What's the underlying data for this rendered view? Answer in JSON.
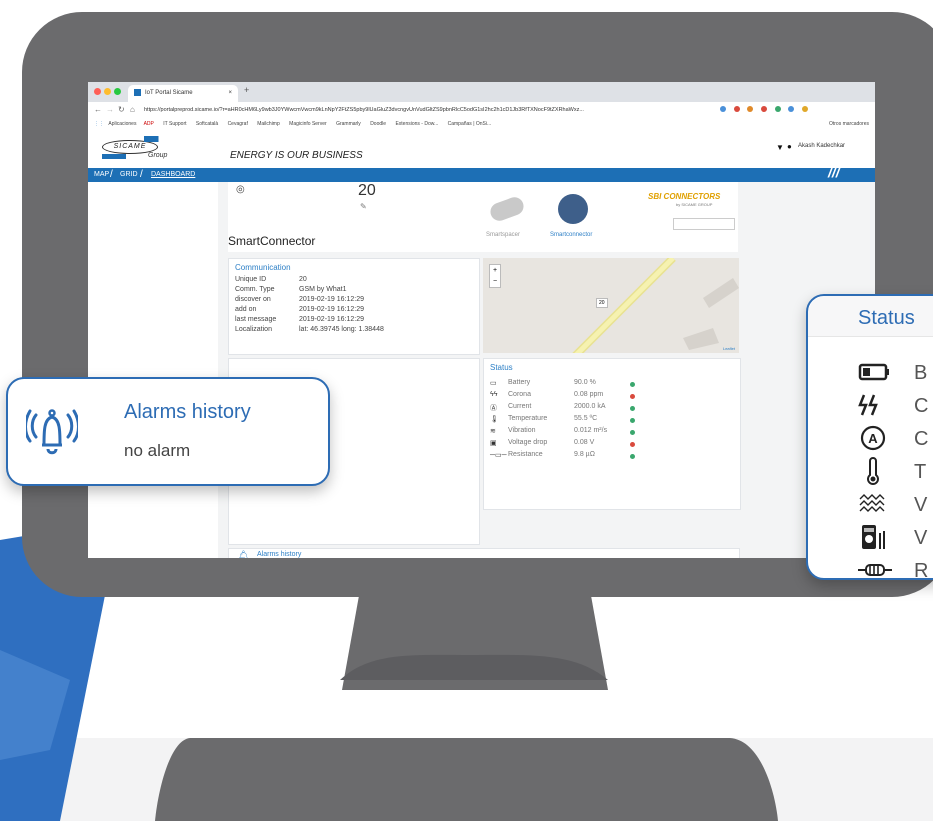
{
  "browser": {
    "tab_title": "IoT Portal Sicame",
    "tab_close": "×",
    "new_tab": "+",
    "url": "https://portalpreprod.sicame.io/?r=aHR0cHM6Ly9wb3J0YWwcmVwcm9kLnNpY2FtZS5pby9lUaGluZ3dvcngvUnVudGltZS9pbnRlcC5odG1sI2hc2h1cD1Jb3RfTXNocF9tZXRhaWxz...",
    "bookmarks": [
      "Aplicaciones",
      "ADP",
      "IT Support",
      "Softcatalà",
      "Cevagraf",
      "Mailchimp",
      "Magicinfo Server",
      "Grammarly",
      "Doodle",
      "Extensions - Dow...",
      "Campañas | OnSi..."
    ],
    "other_bookmarks": "Otros marcadores"
  },
  "site": {
    "logo_name": "SICAME",
    "logo_group": "Group",
    "tagline": "ENERGY IS OUR BUSINESS",
    "user": "Akash Kadechkar",
    "nav": [
      "MAP",
      "GRID",
      "DASHBOARD"
    ]
  },
  "device": {
    "id": "20",
    "name": "SmartConnector",
    "models": [
      "Smartspacer",
      "Smartconnector"
    ],
    "brand": "SBI CONNECTORS",
    "brand_sub": "by SICAME GROUP"
  },
  "communication": {
    "title": "Communication",
    "rows": [
      {
        "label": "Unique ID",
        "value": "20"
      },
      {
        "label": "Comm. Type",
        "value": "GSM by What1"
      },
      {
        "label": "discover on",
        "value": "2019-02-19 16:12:29"
      },
      {
        "label": "add on",
        "value": "2019-02-19 16:12:29"
      },
      {
        "label": "last message",
        "value": "2019-02-19 16:12:29"
      },
      {
        "label": "Localization",
        "value": "lat: 46.39745 long: 1.38448"
      }
    ]
  },
  "map": {
    "zoom_in": "+",
    "zoom_out": "−",
    "marker": "20",
    "attribution": "Leaflet"
  },
  "status": {
    "title": "Status",
    "rows": [
      {
        "icon": "battery-icon",
        "label": "Battery",
        "value": "90.0 %",
        "state": "#3aa76d"
      },
      {
        "icon": "lightning-icon",
        "label": "Corona",
        "value": "0.08 ppm",
        "state": "#d94a3d"
      },
      {
        "icon": "ampere-icon",
        "label": "Current",
        "value": "2000.0 kA",
        "state": "#3aa76d"
      },
      {
        "icon": "thermometer-icon",
        "label": "Temperature",
        "value": "55.5 ºC",
        "state": "#3aa76d"
      },
      {
        "icon": "vibration-icon",
        "label": "Vibration",
        "value": "0.012 m²/s",
        "state": "#3aa76d"
      },
      {
        "icon": "voltmeter-icon",
        "label": "Voltage drop",
        "value": "0.08 V",
        "state": "#d94a3d"
      },
      {
        "icon": "resistor-icon",
        "label": "Resistance",
        "value": "9.8 µΩ",
        "state": "#3aa76d"
      }
    ],
    "big_letters": [
      "B",
      "C",
      "C",
      "T",
      "V",
      "V",
      "R"
    ]
  },
  "alarms": {
    "title": "Alarms history",
    "empty": "no alarm"
  },
  "colors": {
    "accent": "#1d6fb5",
    "popup_border": "#2d6cb4",
    "bezel": "#6b6b6d",
    "ok": "#3aa76d",
    "alert": "#d94a3d"
  }
}
